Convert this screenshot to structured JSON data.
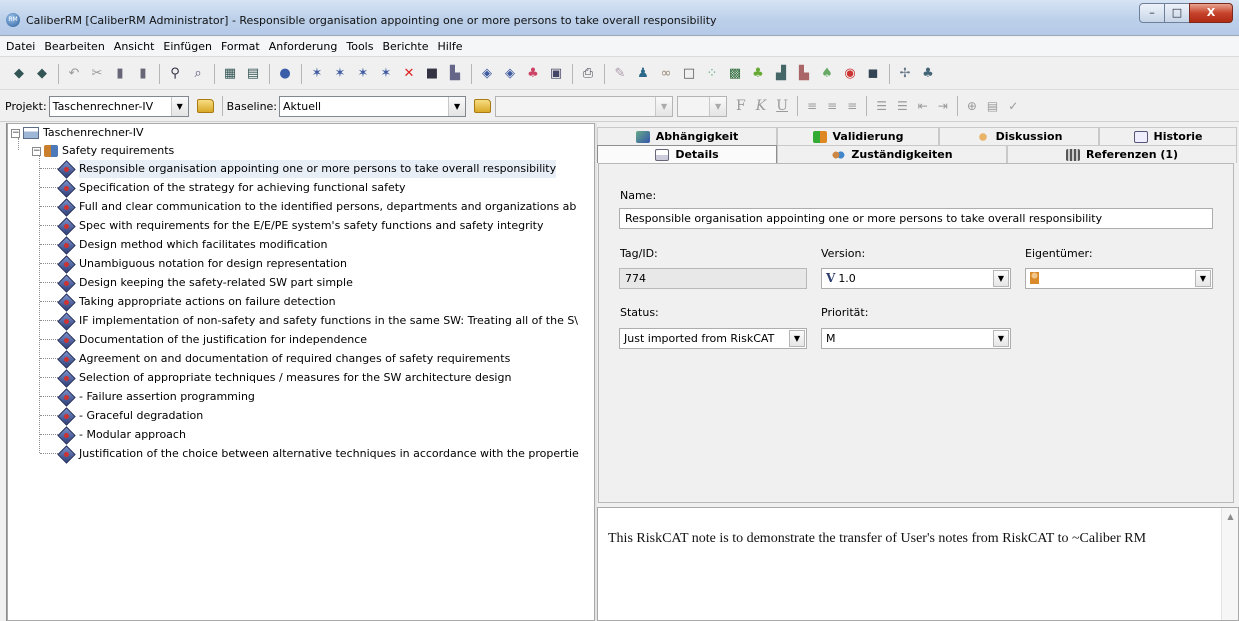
{
  "window": {
    "title": "CaliberRM [CaliberRM Administrator] - Responsible organisation appointing one or more persons to take overall responsibility",
    "minimize": "–",
    "maximize": "□",
    "close": "X"
  },
  "menu": [
    "Datei",
    "Bearbeiten",
    "Ansicht",
    "Einfügen",
    "Format",
    "Anforderung",
    "Tools",
    "Berichte",
    "Hilfe"
  ],
  "toolbar2": {
    "projekt_label": "Projekt:",
    "projekt_value": "Taschenrechner-IV",
    "baseline_label": "Baseline:",
    "baseline_value": "Aktuell",
    "bold": "F",
    "italic": "K",
    "underline": "U"
  },
  "tree": {
    "root": "Taschenrechner-IV",
    "group": "Safety requirements",
    "items": [
      "Responsible organisation appointing one or more persons to take overall responsibility",
      "Specification of the strategy for achieving functional safety",
      "Full and clear communication to the identified persons, departments and organizations ab",
      "Spec with requirements for the E/E/PE system's safety functions and safety integrity",
      "Design method which facilitates modification",
      "Unambiguous notation for design representation",
      "Design keeping the safety-related SW part simple",
      "Taking appropriate actions on failure detection",
      "IF implementation of non-safety and safety functions in the same SW: Treating all of the S\\",
      "Documentation of the justification for independence",
      "Agreement on and documentation of required changes of safety requirements",
      "Selection of appropriate techniques / measures for the SW architecture design",
      "- Failure assertion programming",
      "- Graceful degradation",
      "- Modular approach",
      "Justification of the choice between alternative techniques in accordance with the propertie"
    ]
  },
  "tabs": {
    "row1": [
      "Abhängigkeit",
      "Validierung",
      "Diskussion",
      "Historie"
    ],
    "row2": [
      "Details",
      "Zuständigkeiten",
      "Referenzen (1)"
    ]
  },
  "details": {
    "name_label": "Name:",
    "name_value": "Responsible organisation appointing one or more persons to take overall responsibility",
    "tag_label": "Tag/ID:",
    "tag_value": "774",
    "version_label": "Version:",
    "version_value": "1.0",
    "version_icon": "V",
    "owner_label": "Eigentümer:",
    "status_label": "Status:",
    "status_value": "Just imported from RiskCAT",
    "priority_label": "Priorität:",
    "priority_value": "M"
  },
  "notes": {
    "text": "This RiskCAT note is to demonstrate the transfer of User's notes from RiskCAT to ~Caliber RM"
  }
}
